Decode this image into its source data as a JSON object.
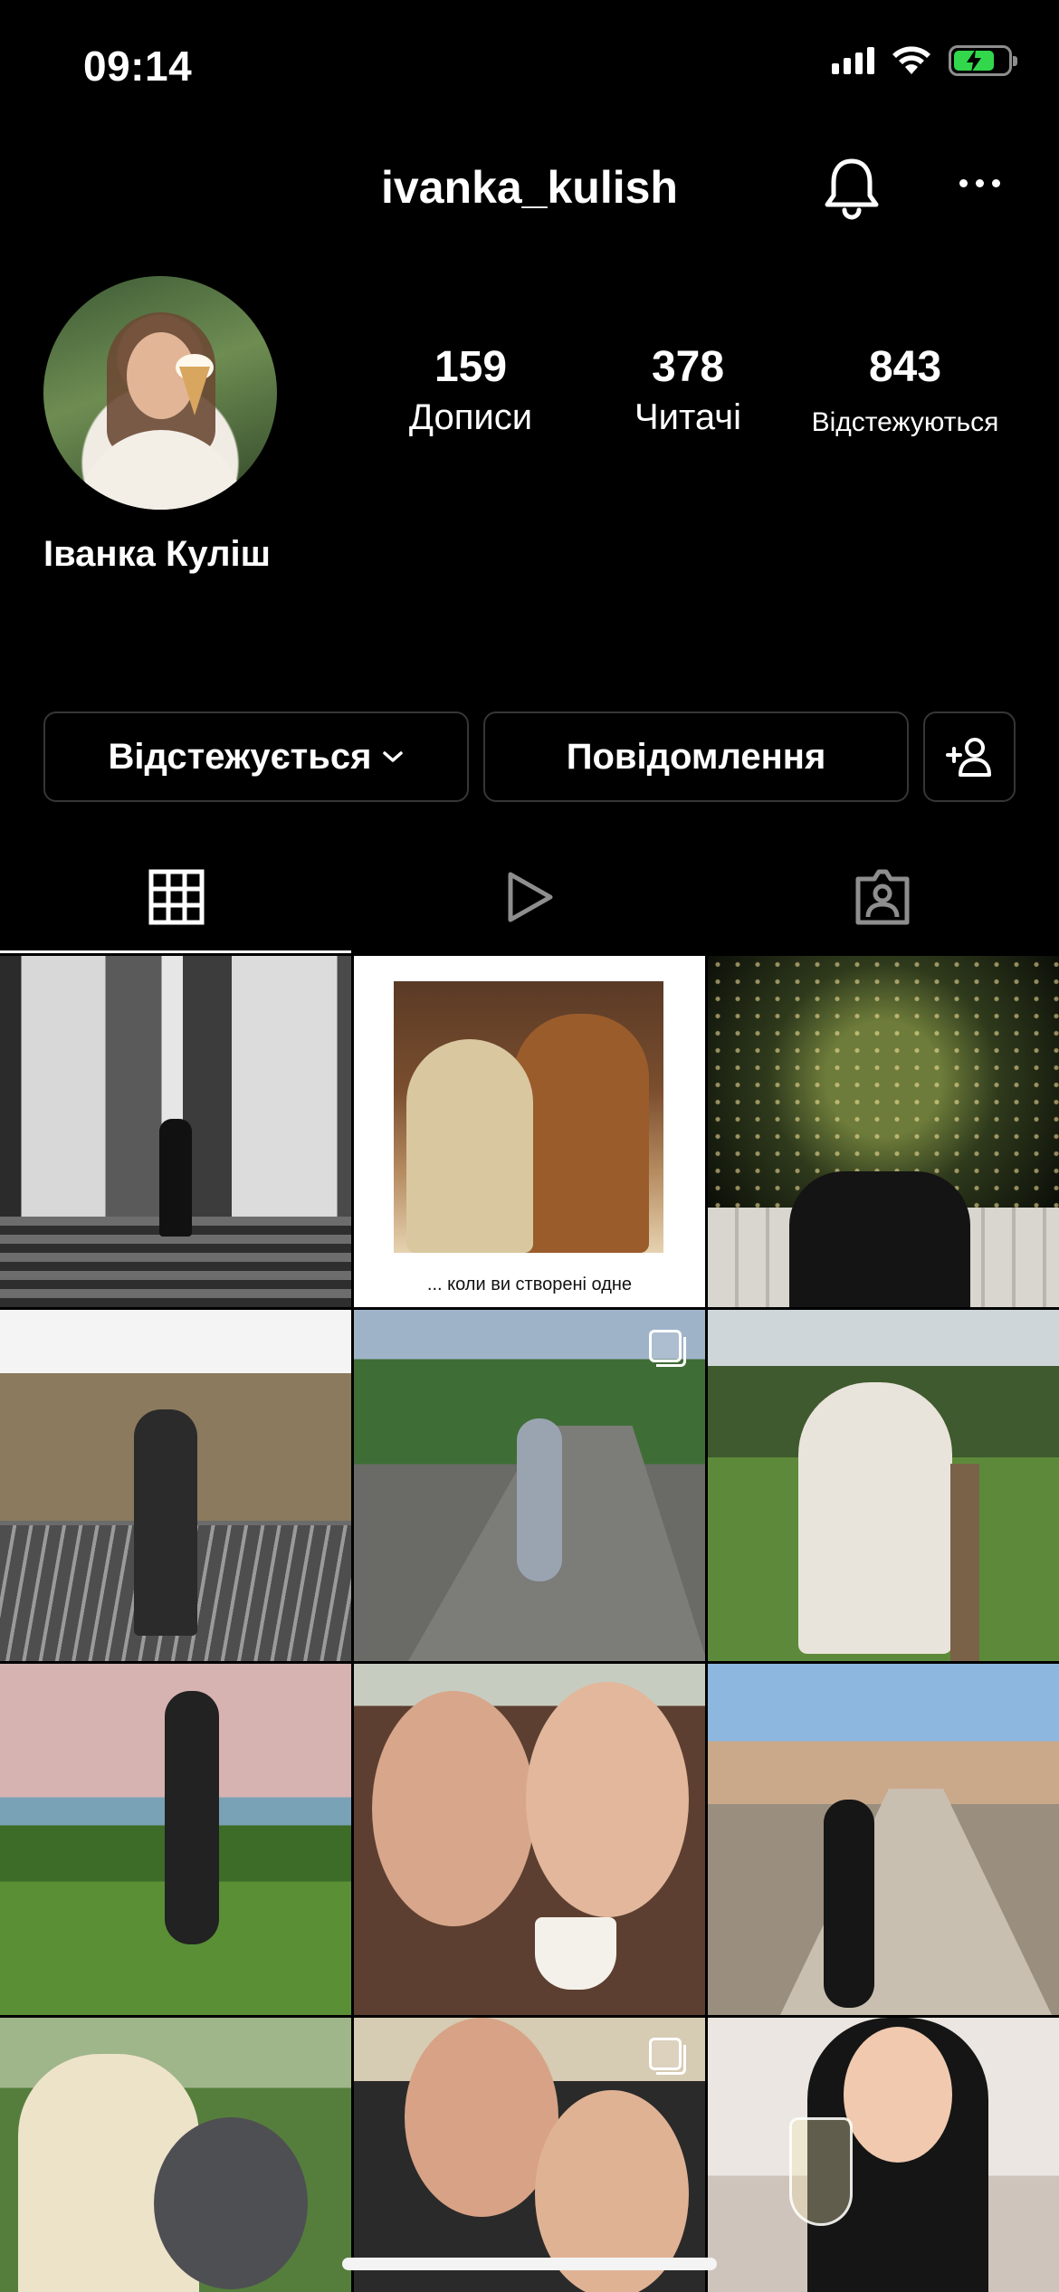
{
  "status_bar": {
    "time": "09:14",
    "battery_percent": 75,
    "battery_color": "#32d74b",
    "signal_icon": "cellular-signal-icon",
    "wifi_icon": "wifi-icon",
    "battery_icon": "battery-charging-icon"
  },
  "header": {
    "username": "ivanka_kulish",
    "notification_icon": "bell-icon",
    "more_icon": "more-horizontal-icon"
  },
  "profile": {
    "full_name": "Іванка Куліш",
    "stats": [
      {
        "value": "159",
        "label": "Дописи"
      },
      {
        "value": "378",
        "label": "Читачі"
      },
      {
        "value": "843",
        "label": "Відстежуються"
      }
    ]
  },
  "actions": {
    "follow_label": "Відстежується",
    "message_label": "Повідомлення",
    "add_user_icon": "add-user-icon"
  },
  "tabs": [
    {
      "name": "grid",
      "icon": "grid-icon",
      "active": true
    },
    {
      "name": "reels",
      "icon": "play-icon",
      "active": false
    },
    {
      "name": "tagged",
      "icon": "tagged-person-icon",
      "active": false
    }
  ],
  "posts": {
    "post2_caption": "... коли ви створені одне",
    "multi_photo_icon": "multiple-photos-icon"
  },
  "colors": {
    "background": "#000000",
    "text": "#ffffff",
    "button_border": "#363636"
  }
}
